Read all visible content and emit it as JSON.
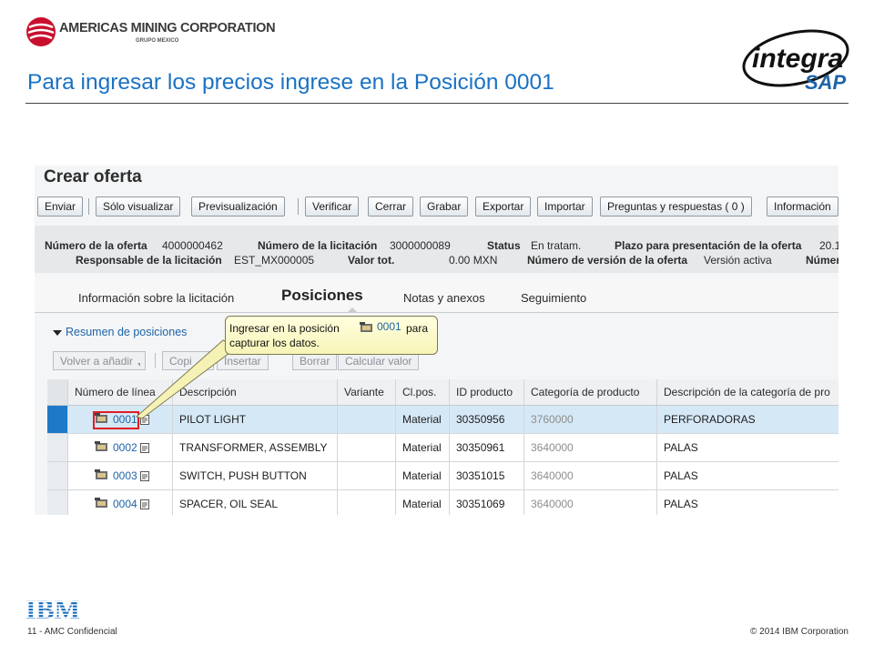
{
  "slide": {
    "brand_name": "AMERICAS MINING CORPORATION",
    "brand_sub": "GRUPO MEXICO",
    "partner_logo": "INTEGRA SAP",
    "title": "Para ingresar los precios ingrese en la Posición 0001",
    "footer_left": "11 - AMC Confidencial",
    "footer_right": "© 2014 IBM Corporation",
    "footer_logo": "IBM"
  },
  "sap": {
    "page_title": "Crear oferta",
    "toolbar": {
      "enviar": "Enviar",
      "solo_visualizar": "Sólo visualizar",
      "previsualizacion": "Previsualización",
      "verificar": "Verificar",
      "cerrar": "Cerrar",
      "grabar": "Grabar",
      "exportar": "Exportar",
      "importar": "Importar",
      "preguntas": "Preguntas y respuestas ( 0 )",
      "informacion": "Información"
    },
    "header_fields": {
      "numero_oferta_label": "Número de la oferta",
      "numero_oferta_value": "4000000462",
      "numero_licitacion_label": "Número de la licitación",
      "numero_licitacion_value": "3000000089",
      "status_label": "Status",
      "status_value": "En tratam.",
      "plazo_label": "Plazo para presentación de la oferta",
      "plazo_value": "20.1",
      "responsable_label": "Responsable de la licitación",
      "responsable_value": "EST_MX000005",
      "valor_label": "Valor tot.",
      "valor_value": "0.00 MXN",
      "version_label": "Número de versión de la oferta",
      "version_value": "Versión activa",
      "trailing_label": "Númer"
    },
    "tabs": {
      "info": "Información sobre la licitación",
      "posiciones": "Posiciones",
      "notas": "Notas y anexos",
      "seguimiento": "Seguimiento"
    },
    "section_title": "Resumen de posiciones",
    "items_toolbar": {
      "volver": "Volver a añadir",
      "copiar": "Copi",
      "insertar": "Insertar",
      "borrar": "Borrar",
      "calcular": "Calcular valor"
    },
    "columns": {
      "linea": "Número de línea",
      "descripcion": "Descripción",
      "variante": "Variante",
      "clpos": "Cl.pos.",
      "producto": "ID producto",
      "categoria": "Categoría de producto",
      "desc_categoria": "Descripción de la categoría de pro"
    },
    "rows": [
      {
        "linea": "0001",
        "descripcion": "PILOT LIGHT",
        "variante": "",
        "clpos": "Material",
        "producto": "30350956",
        "categoria": "3760000",
        "desc_categoria": "PERFORADORAS"
      },
      {
        "linea": "0002",
        "descripcion": "TRANSFORMER, ASSEMBLY",
        "variante": "",
        "clpos": "Material",
        "producto": "30350961",
        "categoria": "3640000",
        "desc_categoria": "PALAS"
      },
      {
        "linea": "0003",
        "descripcion": "SWITCH, PUSH BUTTON",
        "variante": "",
        "clpos": "Material",
        "producto": "30351015",
        "categoria": "3640000",
        "desc_categoria": "PALAS"
      },
      {
        "linea": "0004",
        "descripcion": "SPACER, OIL SEAL",
        "variante": "",
        "clpos": "Material",
        "producto": "30351069",
        "categoria": "3640000",
        "desc_categoria": "PALAS"
      }
    ],
    "callout": {
      "line1_a": "Ingresar en la posición",
      "position": "0001",
      "line1_b": "para",
      "line2": "capturar los datos."
    }
  },
  "colors": {
    "title_blue": "#1a72c4",
    "link_blue": "#1f64a8",
    "highlight_red": "#e21b23",
    "selected_row": "#d5e8f5",
    "ibm_blue": "#1f70c1"
  }
}
